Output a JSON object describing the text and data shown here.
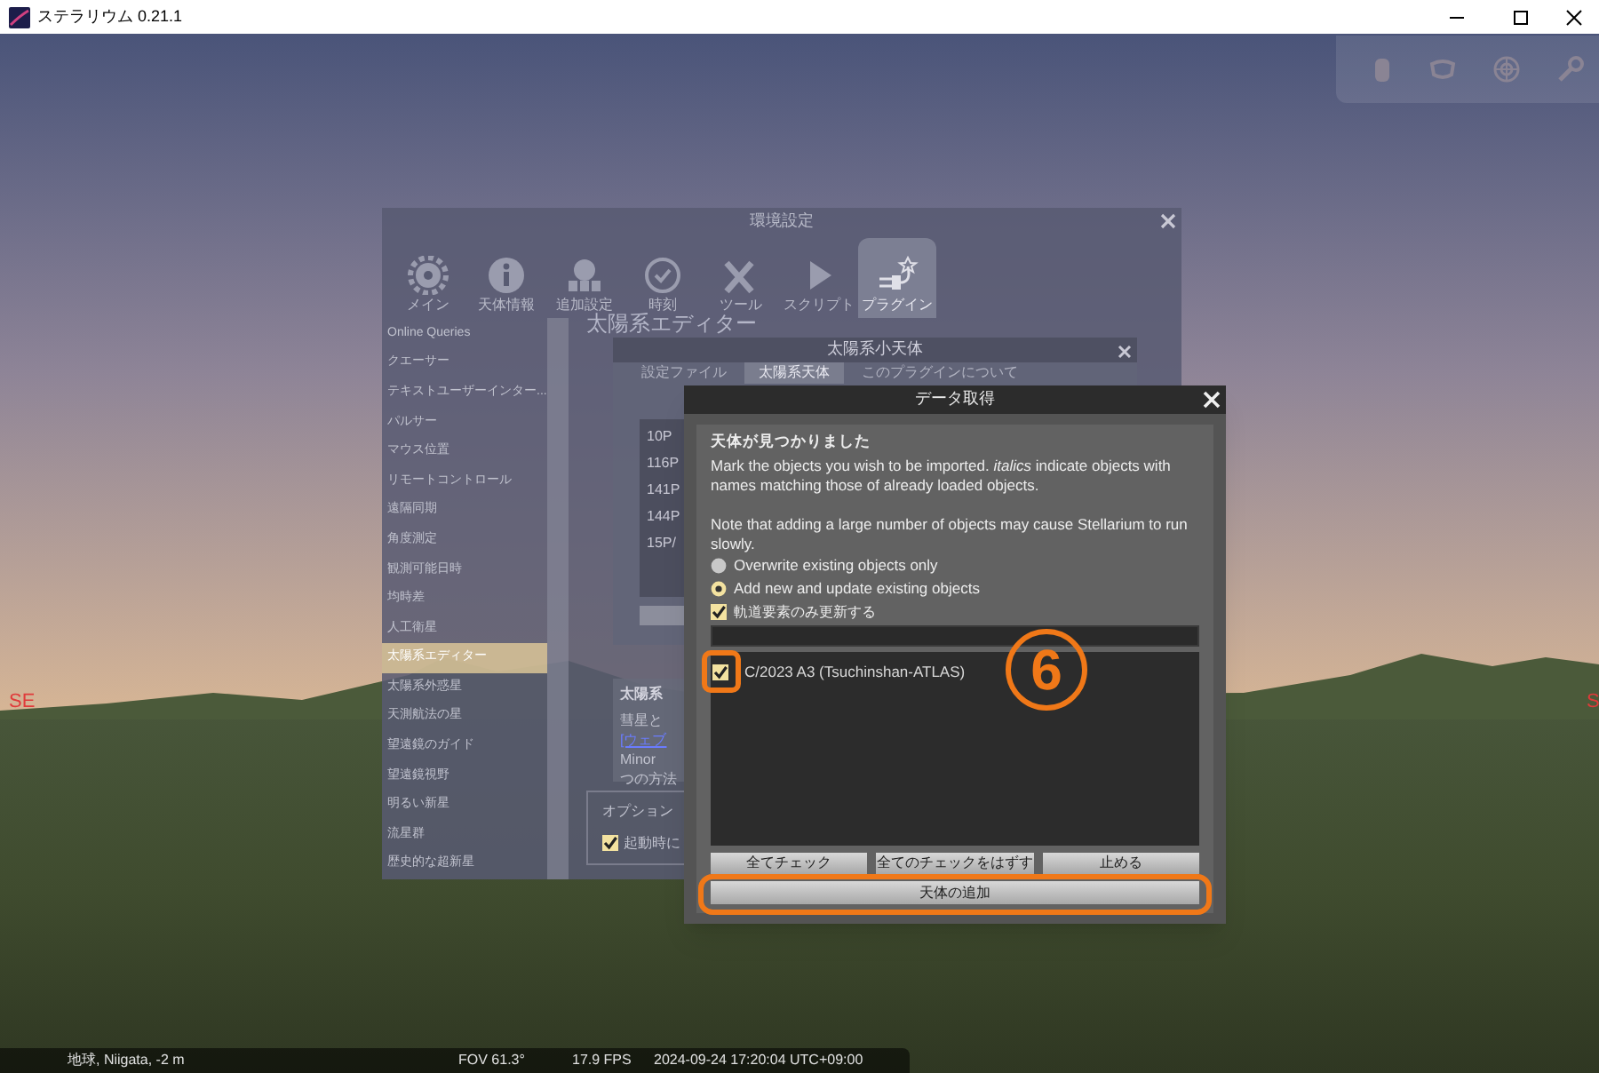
{
  "window": {
    "title": "ステラリウム 0.21.1"
  },
  "compass": [
    {
      "label": "SE"
    },
    {
      "label": "S"
    }
  ],
  "settings_dialog": {
    "title": "環境設定",
    "tabs": [
      {
        "label": "メイン",
        "selected": false
      },
      {
        "label": "天体情報",
        "selected": false
      },
      {
        "label": "追加設定",
        "selected": false
      },
      {
        "label": "時刻",
        "selected": false
      },
      {
        "label": "ツール",
        "selected": false
      },
      {
        "label": "スクリプト",
        "selected": false
      },
      {
        "label": "プラグイン",
        "selected": true
      }
    ],
    "sidebar": {
      "items": [
        {
          "label": "Online Queries",
          "selected": false
        },
        {
          "label": "クエーサー",
          "selected": false
        },
        {
          "label": "テキストユーザーインター...",
          "selected": false
        },
        {
          "label": "パルサー",
          "selected": false
        },
        {
          "label": "マウス位置",
          "selected": false
        },
        {
          "label": "リモートコントロール",
          "selected": false
        },
        {
          "label": "遠隔同期",
          "selected": false
        },
        {
          "label": "角度測定",
          "selected": false
        },
        {
          "label": "観測可能日時",
          "selected": false
        },
        {
          "label": "均時差",
          "selected": false
        },
        {
          "label": "人工衛星",
          "selected": false
        },
        {
          "label": "太陽系エディター",
          "selected": true
        },
        {
          "label": "太陽系外惑星",
          "selected": false
        },
        {
          "label": "天測航法の星",
          "selected": false
        },
        {
          "label": "望遠鏡のガイド",
          "selected": false
        },
        {
          "label": "望遠鏡視野",
          "selected": false
        },
        {
          "label": "明るい新星",
          "selected": false
        },
        {
          "label": "流星群",
          "selected": false
        },
        {
          "label": "歴史的な超新星",
          "selected": false
        }
      ]
    },
    "heading": "太陽系エディター",
    "sub_dialog": {
      "title": "太陽系小天体",
      "tabs": [
        {
          "label": "設定ファイル",
          "selected": false
        },
        {
          "label": "太陽系天体",
          "selected": true
        },
        {
          "label": "このプラグインについて",
          "selected": false
        }
      ],
      "list": [
        "10P",
        "116P",
        "141P",
        "144P",
        "15P/"
      ]
    },
    "info_panel": {
      "heading": "太陽系",
      "lines": [
        "彗星と",
        "[ウェブ",
        "Minor",
        "つの方法"
      ]
    },
    "options": {
      "title": "オプション",
      "checkbox": {
        "label": "起動時に",
        "checked": true
      }
    }
  },
  "data_dialog": {
    "title": "データ取得",
    "heading": "天体が見つかりました",
    "message": "Mark the objects you wish to be imported. *italics* indicate objects with names matching those of already loaded objects.",
    "note": "Note that adding a large number of objects may cause Stellarium to run slowly.",
    "radios": [
      {
        "label": "Overwrite existing objects only",
        "selected": false
      },
      {
        "label": "Add new and update existing objects",
        "selected": true
      }
    ],
    "checkbox": {
      "label": "軌道要素のみ更新する",
      "checked": true
    },
    "objects": [
      {
        "name": "C/2023 A3 (Tsuchinshan-ATLAS)",
        "checked": true
      }
    ],
    "buttons": [
      "全てチェック",
      "全てのチェックをはずす",
      "止める"
    ],
    "add_button": "天体の追加"
  },
  "annotation": {
    "label": "6"
  },
  "status_bar": {
    "location": "地球, Niigata, -2 m",
    "fov": "FOV 61.3°",
    "fps": "17.9 FPS",
    "datetime": "2024-09-24 17:20:04 UTC+09:00"
  }
}
